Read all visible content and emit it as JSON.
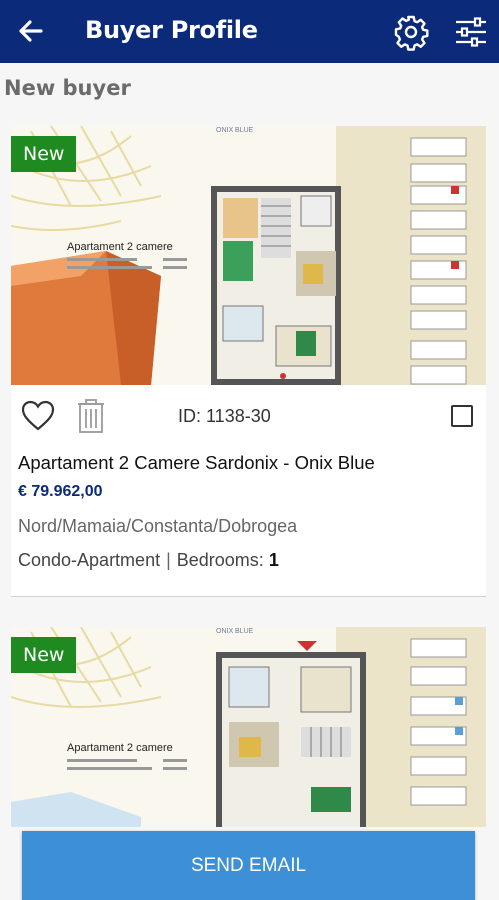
{
  "header": {
    "title": "Buyer Profile",
    "back_icon": "arrow-left-icon",
    "settings_icon": "gear-icon",
    "filter_icon": "sliders-icon"
  },
  "section": {
    "title": "New buyer"
  },
  "listings": [
    {
      "badge": "New",
      "brochure_title": "Apartament 2 camere",
      "brand_mark": "ONIX BLUE",
      "id_label": "ID: 1138-30",
      "name": "Apartament 2 Camere Sardonix - Onix Blue",
      "price": "€ 79.962,00",
      "location": "Nord/Mamaia/Constanta/Dobrogea",
      "type": "Condo-Apartment",
      "bedrooms_label": "Bedrooms:",
      "bedrooms": "1"
    },
    {
      "badge": "New",
      "brochure_title": "Apartament 2 camere",
      "brand_mark": "ONIX BLUE"
    }
  ],
  "actions": {
    "send_email": "SEND EMAIL"
  },
  "colors": {
    "header": "#0c2a7a",
    "badge": "#1f8a1f",
    "price": "#0c2a7a",
    "button": "#3d8fd6"
  }
}
